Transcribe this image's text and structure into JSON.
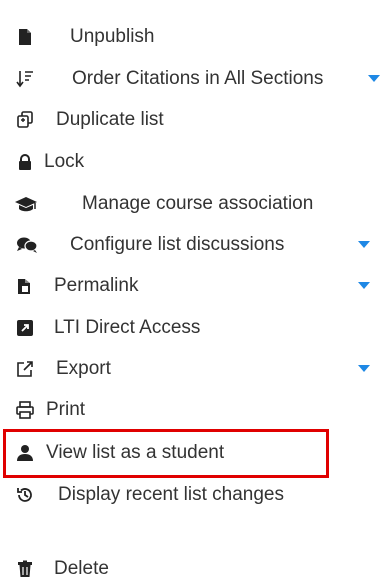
{
  "menu": {
    "items": [
      {
        "label": "Unpublish",
        "icon": "document-icon"
      },
      {
        "label": "Order Citations in All Sections",
        "icon": "sort-icon",
        "has_dropdown": true
      },
      {
        "label": "Duplicate list",
        "icon": "duplicate-icon"
      },
      {
        "label": "Lock",
        "icon": "lock-icon"
      },
      {
        "label": "Manage course association",
        "icon": "graduation-cap-icon"
      },
      {
        "label": "Configure list discussions",
        "icon": "discussions-icon",
        "has_dropdown": true
      },
      {
        "label": "Permalink",
        "icon": "permalink-icon",
        "has_dropdown": true
      },
      {
        "label": "LTI Direct Access",
        "icon": "external-link-square-icon"
      },
      {
        "label": "Export",
        "icon": "export-icon",
        "has_dropdown": true
      },
      {
        "label": "Print",
        "icon": "print-icon"
      },
      {
        "label": "View list as a student",
        "icon": "user-icon",
        "highlighted": true
      },
      {
        "label": "Display recent list changes",
        "icon": "history-icon"
      },
      {
        "label": "Delete",
        "icon": "trash-icon"
      }
    ]
  },
  "colors": {
    "caret": "#1e88e5",
    "highlight_border": "#e00000",
    "text": "#333333"
  }
}
